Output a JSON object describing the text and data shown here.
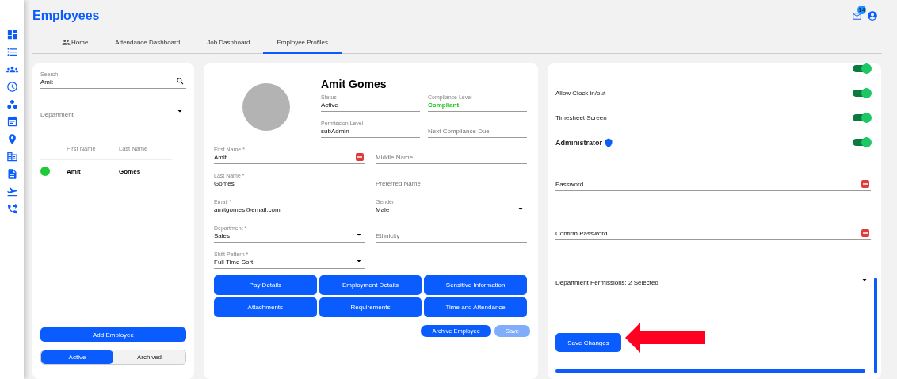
{
  "header": {
    "title": "Employees",
    "mail_badge": "14"
  },
  "tabs": [
    {
      "label": "Home",
      "selected": false
    },
    {
      "label": "Attendance Dashboard",
      "selected": false
    },
    {
      "label": "Job Dashboard",
      "selected": false
    },
    {
      "label": "Employee Profiles",
      "selected": true
    }
  ],
  "employee_list": {
    "search": {
      "label": "Search",
      "value": "Amit"
    },
    "department": {
      "placeholder": "Department"
    },
    "columns": [
      "First Name",
      "Last Name"
    ],
    "rows": [
      {
        "first_name": "Amit",
        "last_name": "Gomes",
        "color": "#1ec93a"
      }
    ],
    "add_button": "Add Employee",
    "filter": [
      {
        "label": "Active",
        "selected": true
      },
      {
        "label": "Archived",
        "selected": false
      }
    ]
  },
  "profile": {
    "name": "Amit Gomes",
    "summary_fields": [
      {
        "label": "Status",
        "value": "Active"
      },
      {
        "label": "Compliance Level",
        "value": "Compliant",
        "color": "#1ec51e"
      },
      {
        "label": "Permission Level",
        "value": "subAdmin"
      },
      {
        "placeholder": "Next Compliance Due"
      }
    ],
    "fields": [
      {
        "kind": "text",
        "label": "First Name *",
        "value": "Amit",
        "autofill_icon": true
      },
      {
        "kind": "text",
        "placeholder": "Middle Name"
      },
      {
        "kind": "text",
        "label": "Last Name *",
        "value": "Gomes"
      },
      {
        "kind": "text",
        "placeholder": "Preferred Name"
      },
      {
        "kind": "text",
        "label": "Email *",
        "value": "amitgomes@email.com"
      },
      {
        "kind": "select",
        "label": "Gender",
        "value": "Male"
      },
      {
        "kind": "select",
        "label": "Department *",
        "value": "Sales"
      },
      {
        "kind": "text",
        "placeholder": "Ethnicity"
      },
      {
        "kind": "select",
        "label": "Shift Pattern *",
        "value": "Full Time Sort"
      }
    ],
    "section_buttons": [
      "Pay Details",
      "Employment Details",
      "Sensitive Information",
      "Attachments",
      "Requirements",
      "Time and Attendance"
    ],
    "archive_button": "Archive Employee",
    "save_button": {
      "label": "Save",
      "disabled": true
    }
  },
  "settings": {
    "toggles": [
      {
        "kind": "plain",
        "on": true
      },
      {
        "kind": "plain",
        "label": "Allow Clock in/out",
        "on": true
      },
      {
        "kind": "plain",
        "label": "Timesheet Screen",
        "on": true
      },
      {
        "kind": "admin",
        "label": "Administrator",
        "on": true
      }
    ],
    "fields": [
      {
        "kind": "password",
        "placeholder": "Password"
      },
      {
        "kind": "password",
        "placeholder": "Confirm Password"
      },
      {
        "kind": "select",
        "value": "Department Permissions: 2 Selected"
      }
    ],
    "save_button": "Save Changes"
  }
}
